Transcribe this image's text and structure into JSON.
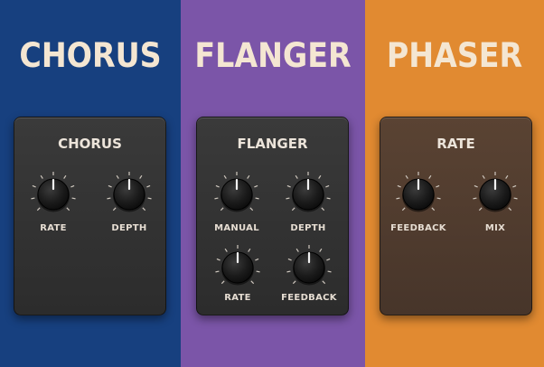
{
  "chorus": {
    "heading": "CHORUS",
    "panel_title": "CHORUS",
    "knobs": [
      {
        "label": "RATE"
      },
      {
        "label": "DEPTH"
      }
    ]
  },
  "flanger": {
    "heading": "FLANGER",
    "panel_title": "FLANGER",
    "knobs": [
      {
        "label": "MANUAL"
      },
      {
        "label": "DEPTH"
      },
      {
        "label": "RATE"
      },
      {
        "label": "FEEDBACK"
      }
    ]
  },
  "phaser": {
    "heading": "PHASER",
    "panel_title": "RATE",
    "knobs": [
      {
        "label": "FEEDBACK"
      },
      {
        "label": "MIX"
      }
    ]
  },
  "colors": {
    "chorus_bg": "#17407f",
    "flanger_bg": "#7b55a8",
    "phaser_bg": "#e18a31",
    "heading_text": "#f4e6d2"
  }
}
